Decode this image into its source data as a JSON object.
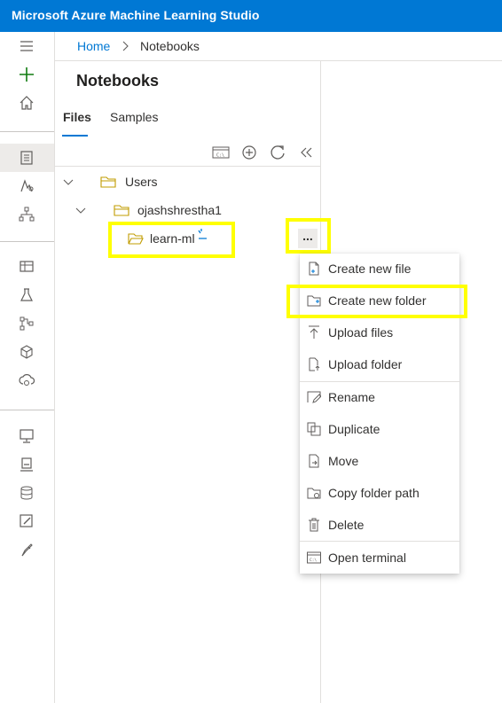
{
  "app": {
    "title": "Microsoft Azure Machine Learning Studio"
  },
  "nav": {
    "icons": [
      "hamburger-icon",
      "plus-icon",
      "home-icon",
      "notebook-icon",
      "automl-icon",
      "designer-icon",
      "datasets-icon",
      "experiments-icon",
      "pipelines-icon",
      "models-icon",
      "endpoints-icon",
      "compute-icon",
      "environments-icon",
      "datastores-icon",
      "data-labeling-icon",
      "linked-services-icon"
    ]
  },
  "breadcrumb": {
    "home": "Home",
    "current": "Notebooks"
  },
  "notebooks": {
    "title": "Notebooks",
    "tabs": {
      "files": "Files",
      "samples": "Samples"
    },
    "tree": {
      "root": "Users",
      "user": "ojashshrestha1",
      "folder": "learn-ml"
    }
  },
  "more_button": {
    "label": "..."
  },
  "context_menu": {
    "items": [
      "Create new file",
      "Create new folder",
      "Upload files",
      "Upload folder",
      "Rename",
      "Duplicate",
      "Move",
      "Copy folder path",
      "Delete",
      "Open terminal"
    ]
  },
  "colors": {
    "brand": "#0078d4",
    "highlight": "#ffff00",
    "folder": "#c19c00"
  }
}
